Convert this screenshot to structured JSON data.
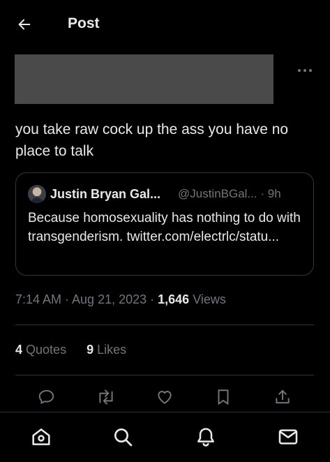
{
  "header": {
    "title": "Post",
    "back_icon": "arrow-left-icon"
  },
  "post": {
    "text": "you take raw cock up the ass you have no place to talk",
    "more_icon": "more-horizontal-icon",
    "timestamp": "7:14 AM · Aug 21, 2023 · ",
    "views_count": "1,646",
    "views_label": "Views"
  },
  "quote": {
    "name": "Justin Bryan Gal...",
    "handle_time": "@JustinBGal... · 9h",
    "text": "Because homosexuality has nothing to do with transgenderism. twitter.com/electrlc/statu..."
  },
  "stats": {
    "quotes_count": "4",
    "quotes_label": "Quotes",
    "likes_count": "9",
    "likes_label": "Likes"
  },
  "actions": [
    "reply-icon",
    "retweet-icon",
    "like-icon",
    "bookmark-icon",
    "share-icon"
  ],
  "nav": [
    "home-icon",
    "search-icon",
    "notifications-icon",
    "messages-icon"
  ],
  "colors": {
    "background": "#000000",
    "text": "#e7e9ea",
    "secondary": "#71767b",
    "border": "#2f3336",
    "redaction": "#4a4a4a"
  }
}
